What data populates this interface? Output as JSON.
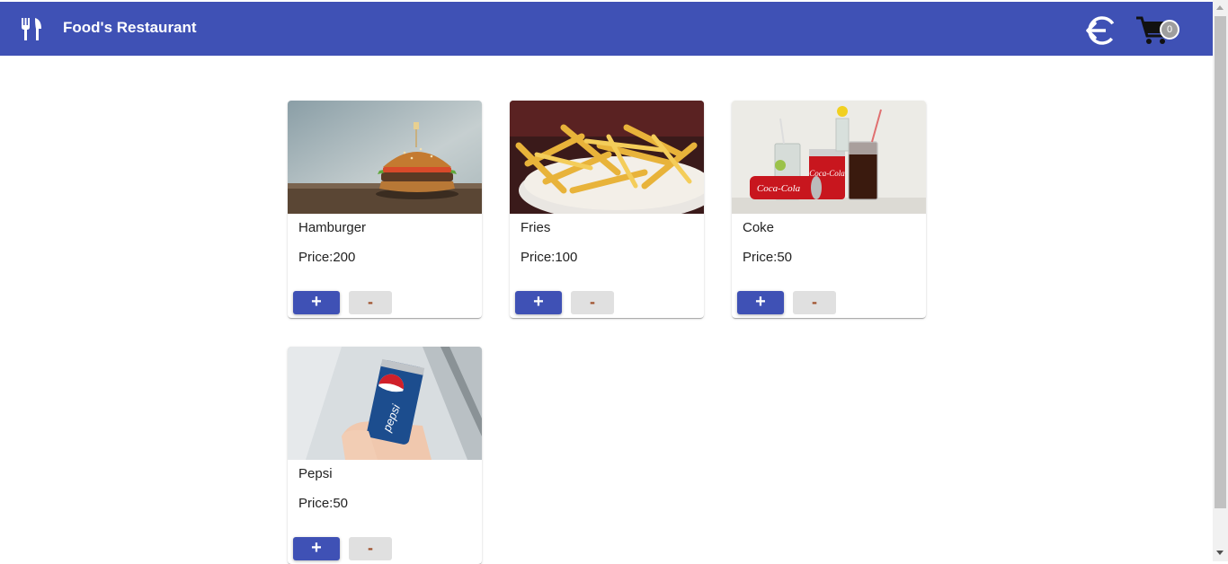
{
  "app": {
    "title": "Food's Restaurant",
    "cart_count": "0",
    "accent_color": "#3f51b5"
  },
  "icons": {
    "brand": "restaurant-icon",
    "logout": "logout-icon",
    "cart": "shopping-cart-icon"
  },
  "products": [
    {
      "name": "Hamburger",
      "price": "Price:200",
      "add_label": "+",
      "remove_label": "-"
    },
    {
      "name": "Fries",
      "price": "Price:100",
      "add_label": "+",
      "remove_label": "-"
    },
    {
      "name": "Coke",
      "price": "Price:50",
      "add_label": "+",
      "remove_label": "-"
    },
    {
      "name": "Pepsi",
      "price": "Price:50",
      "add_label": "+",
      "remove_label": "-"
    }
  ]
}
